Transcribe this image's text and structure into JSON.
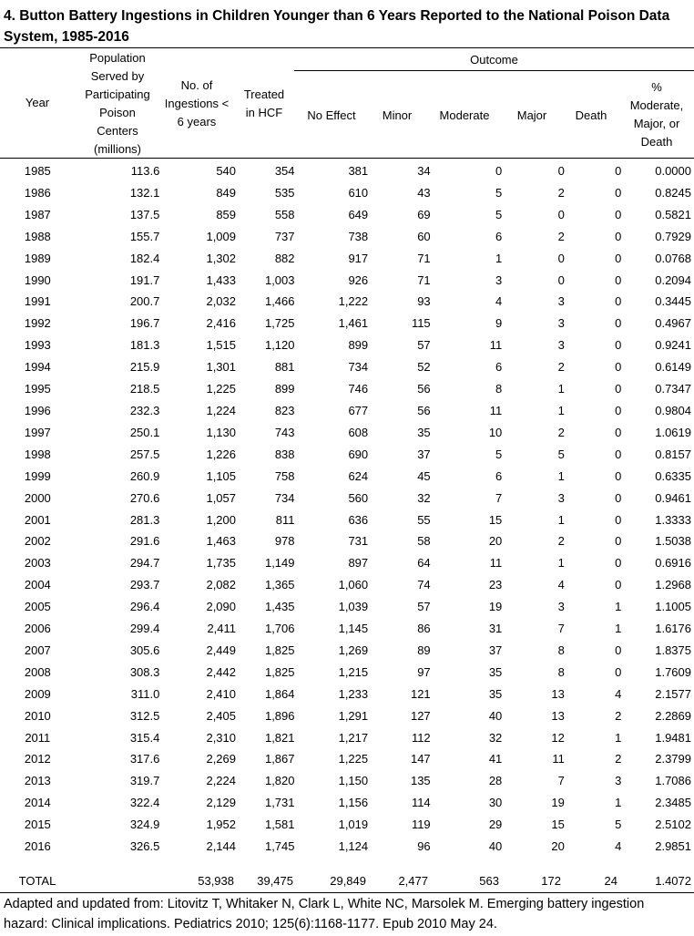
{
  "title": "4. Button Battery Ingestions in Children Younger than 6 Years Reported to the National Poison Data System, 1985-2016",
  "headers": {
    "year": "Year",
    "population": "Population\nServed by\nParticipating\nPoison\nCenters\n(millions)",
    "ingestions": "No. of\nIngestions <\n6 years",
    "treated": "Treated\nin HCF",
    "outcome": "Outcome",
    "no_effect": "No Effect",
    "minor": "Minor",
    "moderate": "Moderate",
    "major": "Major",
    "death": "Death",
    "pct": "%\nModerate,\nMajor, or\nDeath"
  },
  "rows": [
    [
      "1985",
      "113.6",
      "540",
      "354",
      "381",
      "34",
      "0",
      "0",
      "0",
      "0.0000"
    ],
    [
      "1986",
      "132.1",
      "849",
      "535",
      "610",
      "43",
      "5",
      "2",
      "0",
      "0.8245"
    ],
    [
      "1987",
      "137.5",
      "859",
      "558",
      "649",
      "69",
      "5",
      "0",
      "0",
      "0.5821"
    ],
    [
      "1988",
      "155.7",
      "1,009",
      "737",
      "738",
      "60",
      "6",
      "2",
      "0",
      "0.7929"
    ],
    [
      "1989",
      "182.4",
      "1,302",
      "882",
      "917",
      "71",
      "1",
      "0",
      "0",
      "0.0768"
    ],
    [
      "1990",
      "191.7",
      "1,433",
      "1,003",
      "926",
      "71",
      "3",
      "0",
      "0",
      "0.2094"
    ],
    [
      "1991",
      "200.7",
      "2,032",
      "1,466",
      "1,222",
      "93",
      "4",
      "3",
      "0",
      "0.3445"
    ],
    [
      "1992",
      "196.7",
      "2,416",
      "1,725",
      "1,461",
      "115",
      "9",
      "3",
      "0",
      "0.4967"
    ],
    [
      "1993",
      "181.3",
      "1,515",
      "1,120",
      "899",
      "57",
      "11",
      "3",
      "0",
      "0.9241"
    ],
    [
      "1994",
      "215.9",
      "1,301",
      "881",
      "734",
      "52",
      "6",
      "2",
      "0",
      "0.6149"
    ],
    [
      "1995",
      "218.5",
      "1,225",
      "899",
      "746",
      "56",
      "8",
      "1",
      "0",
      "0.7347"
    ],
    [
      "1996",
      "232.3",
      "1,224",
      "823",
      "677",
      "56",
      "11",
      "1",
      "0",
      "0.9804"
    ],
    [
      "1997",
      "250.1",
      "1,130",
      "743",
      "608",
      "35",
      "10",
      "2",
      "0",
      "1.0619"
    ],
    [
      "1998",
      "257.5",
      "1,226",
      "838",
      "690",
      "37",
      "5",
      "5",
      "0",
      "0.8157"
    ],
    [
      "1999",
      "260.9",
      "1,105",
      "758",
      "624",
      "45",
      "6",
      "1",
      "0",
      "0.6335"
    ],
    [
      "2000",
      "270.6",
      "1,057",
      "734",
      "560",
      "32",
      "7",
      "3",
      "0",
      "0.9461"
    ],
    [
      "2001",
      "281.3",
      "1,200",
      "811",
      "636",
      "55",
      "15",
      "1",
      "0",
      "1.3333"
    ],
    [
      "2002",
      "291.6",
      "1,463",
      "978",
      "731",
      "58",
      "20",
      "2",
      "0",
      "1.5038"
    ],
    [
      "2003",
      "294.7",
      "1,735",
      "1,149",
      "897",
      "64",
      "11",
      "1",
      "0",
      "0.6916"
    ],
    [
      "2004",
      "293.7",
      "2,082",
      "1,365",
      "1,060",
      "74",
      "23",
      "4",
      "0",
      "1.2968"
    ],
    [
      "2005",
      "296.4",
      "2,090",
      "1,435",
      "1,039",
      "57",
      "19",
      "3",
      "1",
      "1.1005"
    ],
    [
      "2006",
      "299.4",
      "2,411",
      "1,706",
      "1,145",
      "86",
      "31",
      "7",
      "1",
      "1.6176"
    ],
    [
      "2007",
      "305.6",
      "2,449",
      "1,825",
      "1,269",
      "89",
      "37",
      "8",
      "0",
      "1.8375"
    ],
    [
      "2008",
      "308.3",
      "2,442",
      "1,825",
      "1,215",
      "97",
      "35",
      "8",
      "0",
      "1.7609"
    ],
    [
      "2009",
      "311.0",
      "2,410",
      "1,864",
      "1,233",
      "121",
      "35",
      "13",
      "4",
      "2.1577"
    ],
    [
      "2010",
      "312.5",
      "2,405",
      "1,896",
      "1,291",
      "127",
      "40",
      "13",
      "2",
      "2.2869"
    ],
    [
      "2011",
      "315.4",
      "2,310",
      "1,821",
      "1,217",
      "112",
      "32",
      "12",
      "1",
      "1.9481"
    ],
    [
      "2012",
      "317.6",
      "2,269",
      "1,867",
      "1,225",
      "147",
      "41",
      "11",
      "2",
      "2.3799"
    ],
    [
      "2013",
      "319.7",
      "2,224",
      "1,820",
      "1,150",
      "135",
      "28",
      "7",
      "3",
      "1.7086"
    ],
    [
      "2014",
      "322.4",
      "2,129",
      "1,731",
      "1,156",
      "114",
      "30",
      "19",
      "1",
      "2.3485"
    ],
    [
      "2015",
      "324.9",
      "1,952",
      "1,581",
      "1,019",
      "119",
      "29",
      "15",
      "5",
      "2.5102"
    ],
    [
      "2016",
      "326.5",
      "2,144",
      "1,745",
      "1,124",
      "96",
      "40",
      "20",
      "4",
      "2.9851"
    ]
  ],
  "total": {
    "label": "TOTAL",
    "ingestions": "53,938",
    "treated": "39,475",
    "no_effect": "29,849",
    "minor": "2,477",
    "moderate": "563",
    "major": "172",
    "death": "24",
    "pct": "1.4072"
  },
  "footnote": "Adapted and updated from: Litovitz T, Whitaker N, Clark L, White NC, Marsolek M. Emerging battery ingestion hazard: Clinical implications.  Pediatrics 2010; 125(6):1168-1177. Epub 2010 May 24."
}
